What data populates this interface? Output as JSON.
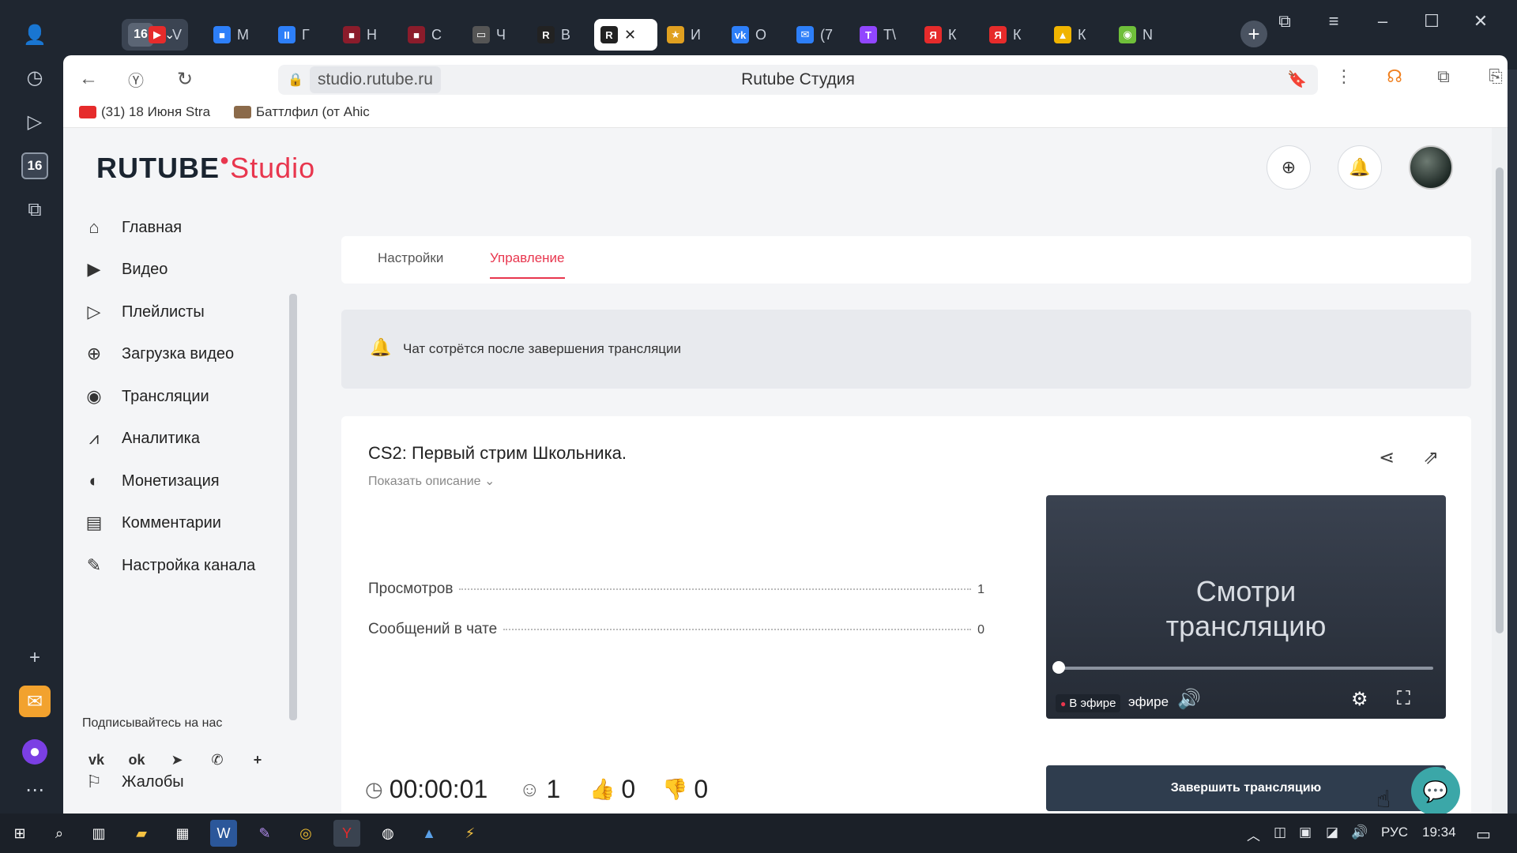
{
  "browser": {
    "group_count": "16",
    "tabs": [
      {
        "fav": "▶",
        "letter": "V",
        "color": "#e62b2b"
      },
      {
        "fav": "■",
        "letter": "M",
        "color": "#2d7ff9"
      },
      {
        "fav": "II",
        "letter": "Г",
        "color": "#2d7ff9"
      },
      {
        "fav": "■",
        "letter": "Н",
        "color": "#8b1c2b"
      },
      {
        "fav": "■",
        "letter": "С",
        "color": "#8b1c2b"
      },
      {
        "fav": "▭",
        "letter": "Ч",
        "color": "#555"
      },
      {
        "fav": "R",
        "letter": "В",
        "color": "#222"
      },
      {
        "fav": "R",
        "letter": "✕",
        "color": "#222"
      },
      {
        "fav": "★",
        "letter": "И",
        "color": "#e0a020"
      },
      {
        "fav": "vk",
        "letter": "О",
        "color": "#2d7ff9"
      },
      {
        "fav": "✉",
        "letter": "(7",
        "color": "#2d7ff9"
      },
      {
        "fav": "T",
        "letter": "Т\\",
        "color": "#9146ff"
      },
      {
        "fav": "Я",
        "letter": "К",
        "color": "#e62b2b"
      },
      {
        "fav": "Я",
        "letter": "К",
        "color": "#e62b2b"
      },
      {
        "fav": "▲",
        "letter": "К",
        "color": "#f0b400"
      },
      {
        "fav": "◉",
        "letter": "N",
        "color": "#6fbf3a"
      }
    ],
    "url": "studio.rutube.ru",
    "page_title": "Rutube Студия",
    "bookmarks": [
      {
        "label": "(31) 18 Июня Stra",
        "color": "#e62b2b"
      },
      {
        "label": "Баттлфил (от Ahic",
        "color": "#8b6a4a"
      }
    ]
  },
  "header": {
    "logo_main": "RUTUBE",
    "logo_sub": "Studio"
  },
  "sidebar": {
    "items": [
      {
        "label": "Главная",
        "icon": "home-icon",
        "glyph": "⌂"
      },
      {
        "label": "Видео",
        "icon": "video-icon",
        "glyph": "▶"
      },
      {
        "label": "Плейлисты",
        "icon": "playlist-icon",
        "glyph": "▷"
      },
      {
        "label": "Загрузка видео",
        "icon": "upload-icon",
        "glyph": "⊕"
      },
      {
        "label": "Трансляции",
        "icon": "broadcast-icon",
        "glyph": "◉"
      },
      {
        "label": "Аналитика",
        "icon": "analytics-icon",
        "glyph": "⩘"
      },
      {
        "label": "Монетизация",
        "icon": "monetization-icon",
        "glyph": "◐"
      },
      {
        "label": "Комментарии",
        "icon": "comments-icon",
        "glyph": "▤"
      },
      {
        "label": "Настройка канала",
        "icon": "wand-icon",
        "glyph": "✎"
      }
    ],
    "follow_label": "Подписывайтесь на нас",
    "socials": [
      {
        "name": "vk-icon",
        "glyph": "vk"
      },
      {
        "name": "ok-icon",
        "glyph": "ok"
      },
      {
        "name": "telegram-icon",
        "glyph": "➤"
      },
      {
        "name": "viber-icon",
        "glyph": "✆"
      },
      {
        "name": "more-icon",
        "glyph": "+"
      }
    ],
    "complaints": "Жалобы"
  },
  "tabs": {
    "settings": "Настройки",
    "manage": "Управление"
  },
  "notice": "Чат сотрётся после завершения трансляции",
  "stream": {
    "title": "CS2: Первый стрим Школьника.",
    "show_description": "Показать описание ⌄",
    "views_label": "Просмотров",
    "views_value": "1",
    "messages_label": "Сообщений в чате",
    "messages_value": "0",
    "player_text_line1": "Смотри",
    "player_text_line2": "трансляцию",
    "live_badge": "В эфире",
    "live_text": "эфире",
    "duration": "00:00:01",
    "viewers": "1",
    "likes": "0",
    "dislikes": "0",
    "end_button": "Завершить трансляцию"
  },
  "taskbar": {
    "lang": "РУС",
    "time": "19:34"
  }
}
